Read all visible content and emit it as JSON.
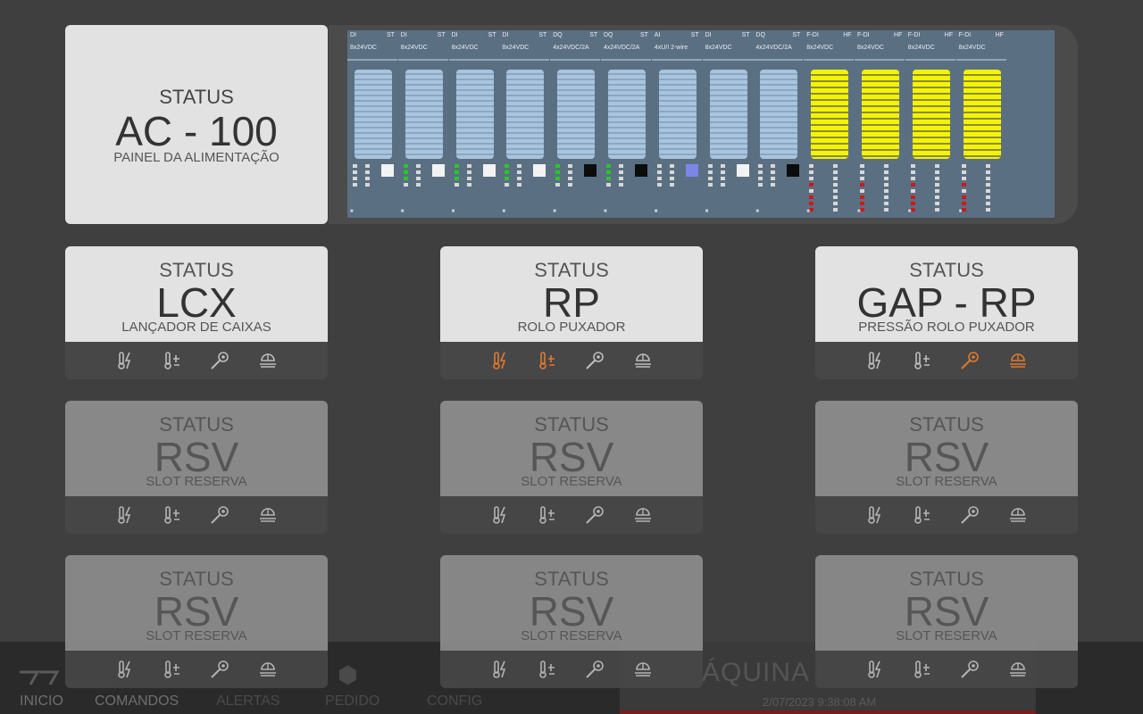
{
  "main": {
    "status_label": "STATUS",
    "name": "AC - 100",
    "subtitle": "PAINEL DA ALIMENTAÇÃO"
  },
  "plc_modules": [
    {
      "type": "DI",
      "st": "ST",
      "spec": "8x24VDC",
      "term": "blue",
      "box": "white"
    },
    {
      "type": "DI",
      "st": "ST",
      "spec": "8x24VDC",
      "term": "blue",
      "box": "white"
    },
    {
      "type": "DI",
      "st": "ST",
      "spec": "8x24VDC",
      "term": "blue",
      "box": "white"
    },
    {
      "type": "DI",
      "st": "ST",
      "spec": "8x24VDC",
      "term": "blue",
      "box": "white"
    },
    {
      "type": "DQ",
      "st": "ST",
      "spec": "4x24VDC/2A",
      "term": "blue",
      "box": "black"
    },
    {
      "type": "DQ",
      "st": "ST",
      "spec": "4x24VDC/2A",
      "term": "blue",
      "box": "black"
    },
    {
      "type": "AI",
      "st": "ST",
      "spec": "4xU/I 2-wire",
      "term": "blue",
      "box": "purple"
    },
    {
      "type": "DI",
      "st": "ST",
      "spec": "8x24VDC",
      "term": "blue",
      "box": "white"
    },
    {
      "type": "DQ",
      "st": "ST",
      "spec": "4x24VDC/2A",
      "term": "blue",
      "box": "black"
    },
    {
      "type": "F-DI",
      "st": "HF",
      "spec": "8x24VDC",
      "term": "yellow",
      "box": ""
    },
    {
      "type": "F-DI",
      "st": "HF",
      "spec": "8x24VDC",
      "term": "yellow",
      "box": ""
    },
    {
      "type": "F-DI",
      "st": "HF",
      "spec": "8x24VDC",
      "term": "yellow",
      "box": ""
    },
    {
      "type": "F-DI",
      "st": "HF",
      "spec": "8x24VDC",
      "term": "yellow",
      "box": ""
    }
  ],
  "cards": [
    {
      "status_label": "STATUS",
      "name": "LCX",
      "subtitle": "LANÇADOR DE CAIXAS",
      "state": "active",
      "icon_colors": [
        "#bdbdbd",
        "#bdbdbd",
        "#bdbdbd",
        "#bdbdbd"
      ]
    },
    {
      "status_label": "STATUS",
      "name": "RP",
      "subtitle": "ROLO PUXADOR",
      "state": "active",
      "icon_colors": [
        "#e07a2e",
        "#e07a2e",
        "#bdbdbd",
        "#bdbdbd"
      ]
    },
    {
      "status_label": "STATUS",
      "name": "GAP - RP",
      "subtitle": "PRESSÃO ROLO PUXADOR",
      "state": "active",
      "icon_colors": [
        "#bdbdbd",
        "#bdbdbd",
        "#e07a2e",
        "#e07a2e"
      ]
    },
    {
      "status_label": "STATUS",
      "name": "RSV",
      "subtitle": "SLOT RESERVA",
      "state": "inactive",
      "icon_colors": [
        "#bdbdbd",
        "#bdbdbd",
        "#bdbdbd",
        "#bdbdbd"
      ]
    },
    {
      "status_label": "STATUS",
      "name": "RSV",
      "subtitle": "SLOT RESERVA",
      "state": "inactive",
      "icon_colors": [
        "#bdbdbd",
        "#bdbdbd",
        "#bdbdbd",
        "#bdbdbd"
      ]
    },
    {
      "status_label": "STATUS",
      "name": "RSV",
      "subtitle": "SLOT RESERVA",
      "state": "inactive",
      "icon_colors": [
        "#bdbdbd",
        "#bdbdbd",
        "#bdbdbd",
        "#bdbdbd"
      ]
    },
    {
      "status_label": "STATUS",
      "name": "RSV",
      "subtitle": "SLOT RESERVA",
      "state": "inactive",
      "icon_colors": [
        "#bdbdbd",
        "#bdbdbd",
        "#bdbdbd",
        "#bdbdbd"
      ]
    },
    {
      "status_label": "STATUS",
      "name": "RSV",
      "subtitle": "SLOT RESERVA",
      "state": "inactive",
      "icon_colors": [
        "#bdbdbd",
        "#bdbdbd",
        "#bdbdbd",
        "#bdbdbd"
      ]
    },
    {
      "status_label": "STATUS",
      "name": "RSV",
      "subtitle": "SLOT RESERVA",
      "state": "inactive",
      "icon_colors": [
        "#bdbdbd",
        "#bdbdbd",
        "#bdbdbd",
        "#bdbdbd"
      ]
    }
  ],
  "card_icons": [
    "thermal-power-icon",
    "thermal-overload-icon",
    "sensor-probe-icon",
    "safety-hand-icon"
  ],
  "footer": {
    "nav": [
      "INICIO",
      "COMANDOS",
      "ALERTAS",
      "PEDIDO",
      "CONFIG"
    ],
    "machine_title": "ÁQUINA D",
    "datetime": "2/07/2023 9:38:08 AM"
  }
}
